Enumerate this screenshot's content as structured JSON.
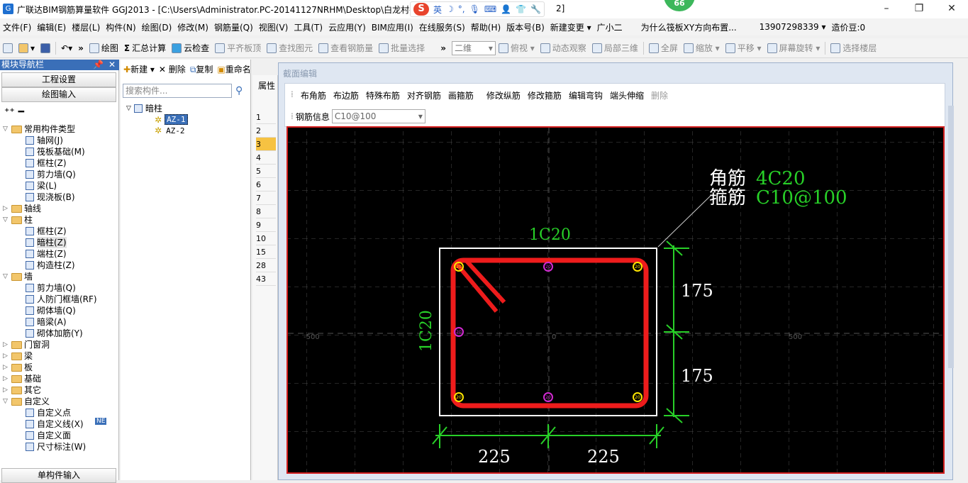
{
  "window": {
    "title": "广联达BIM钢筋算量软件 GGJ2013 - [C:\\Users\\Administrator.PC-20141127NRHM\\Desktop\\白龙村-",
    "title_tail": "2]",
    "badge": "66",
    "ime": {
      "logo": "S",
      "lang": "英"
    }
  },
  "menu": [
    "文件(F)",
    "编辑(E)",
    "楼层(L)",
    "构件(N)",
    "绘图(D)",
    "修改(M)",
    "钢筋量(Q)",
    "视图(V)",
    "工具(T)",
    "云应用(Y)",
    "BIM应用(I)",
    "在线服务(S)",
    "帮助(H)",
    "版本号(B)",
    "新建变更 ▾",
    "广小二",
    "为什么筏板XY方向布置...",
    "13907298339 ▾",
    "造价豆:0"
  ],
  "toolbar": {
    "items": [
      "绘图",
      "汇总计算",
      "云检查",
      "平齐板顶",
      "查找图元",
      "查看钢筋量",
      "批量选择"
    ],
    "view_mode": "二维",
    "right_items": [
      "俯视 ▾",
      "动态观察",
      "局部三维",
      "全屏",
      "缩放 ▾",
      "平移 ▾",
      "屏幕旋转 ▾",
      "选择楼层"
    ]
  },
  "nav": {
    "header": "模块导航栏",
    "btn_settings": "工程设置",
    "btn_draw": "绘图输入",
    "btn_single": "单构件输入",
    "tree": [
      {
        "level": 0,
        "type": "folder",
        "exp": "−",
        "label": "常用构件类型"
      },
      {
        "level": 1,
        "type": "leaf",
        "label": "轴网(J)"
      },
      {
        "level": 1,
        "type": "leaf",
        "label": "筏板基础(M)"
      },
      {
        "level": 1,
        "type": "leaf",
        "label": "框柱(Z)"
      },
      {
        "level": 1,
        "type": "leaf",
        "label": "剪力墙(Q)"
      },
      {
        "level": 1,
        "type": "leaf",
        "label": "梁(L)"
      },
      {
        "level": 1,
        "type": "leaf",
        "label": "现浇板(B)"
      },
      {
        "level": 0,
        "type": "folder",
        "exp": "+",
        "label": "轴线"
      },
      {
        "level": 0,
        "type": "folder",
        "exp": "−",
        "label": "柱"
      },
      {
        "level": 1,
        "type": "leaf",
        "label": "框柱(Z)"
      },
      {
        "level": 1,
        "type": "leaf",
        "label": "暗柱(Z)"
      },
      {
        "level": 1,
        "type": "leaf",
        "label": "端柱(Z)"
      },
      {
        "level": 1,
        "type": "leaf",
        "label": "构造柱(Z)"
      },
      {
        "level": 0,
        "type": "folder",
        "exp": "−",
        "label": "墙"
      },
      {
        "level": 1,
        "type": "leaf",
        "label": "剪力墙(Q)"
      },
      {
        "level": 1,
        "type": "leaf",
        "label": "人防门框墙(RF)"
      },
      {
        "level": 1,
        "type": "leaf",
        "label": "砌体墙(Q)"
      },
      {
        "level": 1,
        "type": "leaf",
        "label": "暗梁(A)"
      },
      {
        "level": 1,
        "type": "leaf",
        "label": "砌体加筋(Y)"
      },
      {
        "level": 0,
        "type": "folder",
        "exp": "+",
        "label": "门窗洞"
      },
      {
        "level": 0,
        "type": "folder",
        "exp": "+",
        "label": "梁"
      },
      {
        "level": 0,
        "type": "folder",
        "exp": "+",
        "label": "板"
      },
      {
        "level": 0,
        "type": "folder",
        "exp": "+",
        "label": "基础"
      },
      {
        "level": 0,
        "type": "folder",
        "exp": "+",
        "label": "其它"
      },
      {
        "level": 0,
        "type": "folder",
        "exp": "−",
        "label": "自定义"
      },
      {
        "level": 1,
        "type": "leaf",
        "label": "自定义点"
      },
      {
        "level": 1,
        "type": "leaf",
        "label": "自定义线(X)"
      },
      {
        "level": 1,
        "type": "leaf",
        "label": "自定义面"
      },
      {
        "level": 1,
        "type": "leaf",
        "label": "尺寸标注(W)"
      }
    ],
    "new_badge": "NE"
  },
  "components": {
    "toolbar": [
      "新建 ▾",
      "删除",
      "复制",
      "重命名"
    ],
    "search_placeholder": "搜索构件...",
    "root": "暗柱",
    "items": [
      "AZ-1",
      "AZ-2"
    ],
    "selected": "AZ-1"
  },
  "props": {
    "header": "属性",
    "rows": [
      "1",
      "2",
      "3",
      "4",
      "5",
      "6",
      "7",
      "8",
      "9",
      "10",
      "15",
      "28",
      "43"
    ]
  },
  "dialog": {
    "title": "截面编辑",
    "tools": [
      "布角筋",
      "布边筋",
      "特殊布筋",
      "对齐钢筋",
      "画箍筋",
      "修改纵筋",
      "修改箍筋",
      "编辑弯钩",
      "端头伸缩",
      "删除"
    ],
    "rebar_info_label": "钢筋信息",
    "rebar_info_value": "C10@100"
  },
  "drawing": {
    "corner_label": "角筋",
    "corner_value": "4C20",
    "stirrup_label": "箍筋",
    "stirrup_value": "C10@100",
    "top_side": "1C20",
    "left_side": "1C20",
    "dim_right_top": "175",
    "dim_right_bottom": "175",
    "dim_bottom_left": "225",
    "dim_bottom_right": "225",
    "axis_left": "-500",
    "axis_center": "0",
    "axis_right": "500",
    "bar_label": "20",
    "colors": {
      "stirrup": "#ee1c1c",
      "dim": "#28d028",
      "text": "#ffffff",
      "corner_bar": "#ffe600",
      "side_bar": "#d22ad2"
    }
  }
}
